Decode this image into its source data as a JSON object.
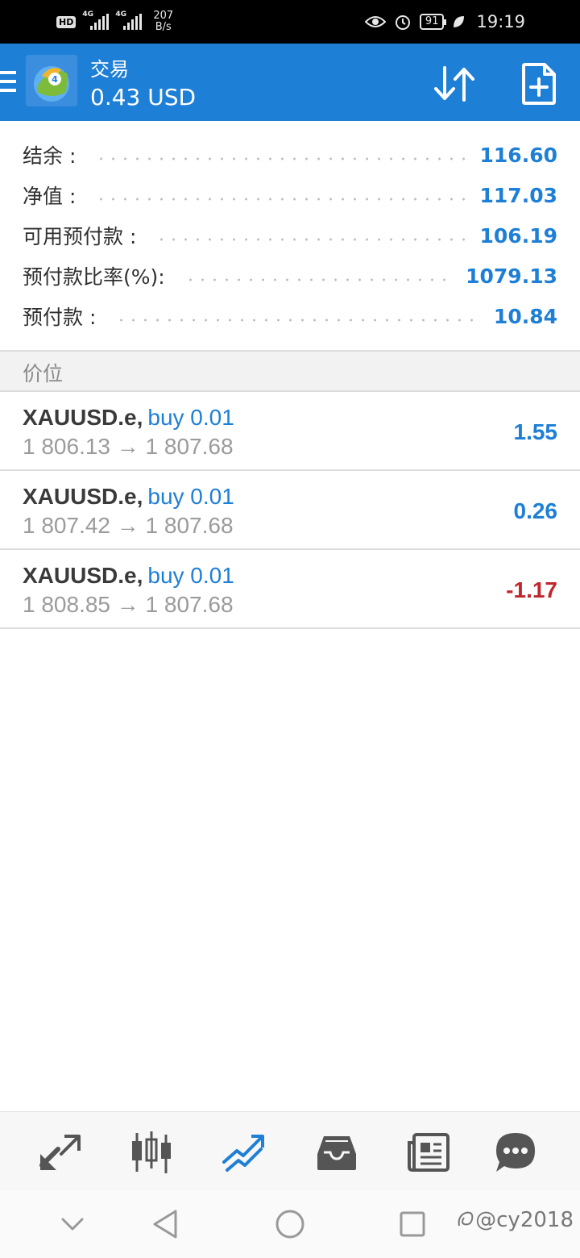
{
  "status_bar": {
    "hd": "HD",
    "net1": "4G",
    "net2": "4G",
    "speed_top": "207",
    "speed_bottom": "B/s",
    "battery": "91",
    "time": "19:19"
  },
  "header": {
    "title": "交易",
    "balance_display": "0.43 USD"
  },
  "summary": [
    {
      "label": "结余 :",
      "value": "116.60"
    },
    {
      "label": "净值 :",
      "value": "117.03"
    },
    {
      "label": "可用预付款 :",
      "value": "106.19"
    },
    {
      "label": "预付款比率(%):",
      "value": "1079.13"
    },
    {
      "label": "预付款 :",
      "value": "10.84"
    }
  ],
  "section": {
    "label": "价位"
  },
  "positions": [
    {
      "symbol": "XAUUSD.e,",
      "side": "buy 0.01",
      "prices": "1 806.13 → 1 807.68",
      "profit": "1.55",
      "profit_sign": "positive"
    },
    {
      "symbol": "XAUUSD.e,",
      "side": "buy 0.01",
      "prices": "1 807.42 → 1 807.68",
      "profit": "0.26",
      "profit_sign": "positive"
    },
    {
      "symbol": "XAUUSD.e,",
      "side": "buy 0.01",
      "prices": "1 808.85 → 1 807.68",
      "profit": "-1.17",
      "profit_sign": "negative"
    }
  ],
  "bottom_nav": [
    {
      "icon": "quotes-arrows-icon",
      "active": false
    },
    {
      "icon": "candlestick-chart-icon",
      "active": false
    },
    {
      "icon": "trade-icon",
      "active": true
    },
    {
      "icon": "history-inbox-icon",
      "active": false
    },
    {
      "icon": "news-icon",
      "active": false
    },
    {
      "icon": "chat-icon",
      "active": false
    }
  ],
  "watermark": "@cy2018",
  "colors": {
    "accent": "#1e7fd6",
    "negative": "#c0262d",
    "inactive_icon": "#555555"
  }
}
